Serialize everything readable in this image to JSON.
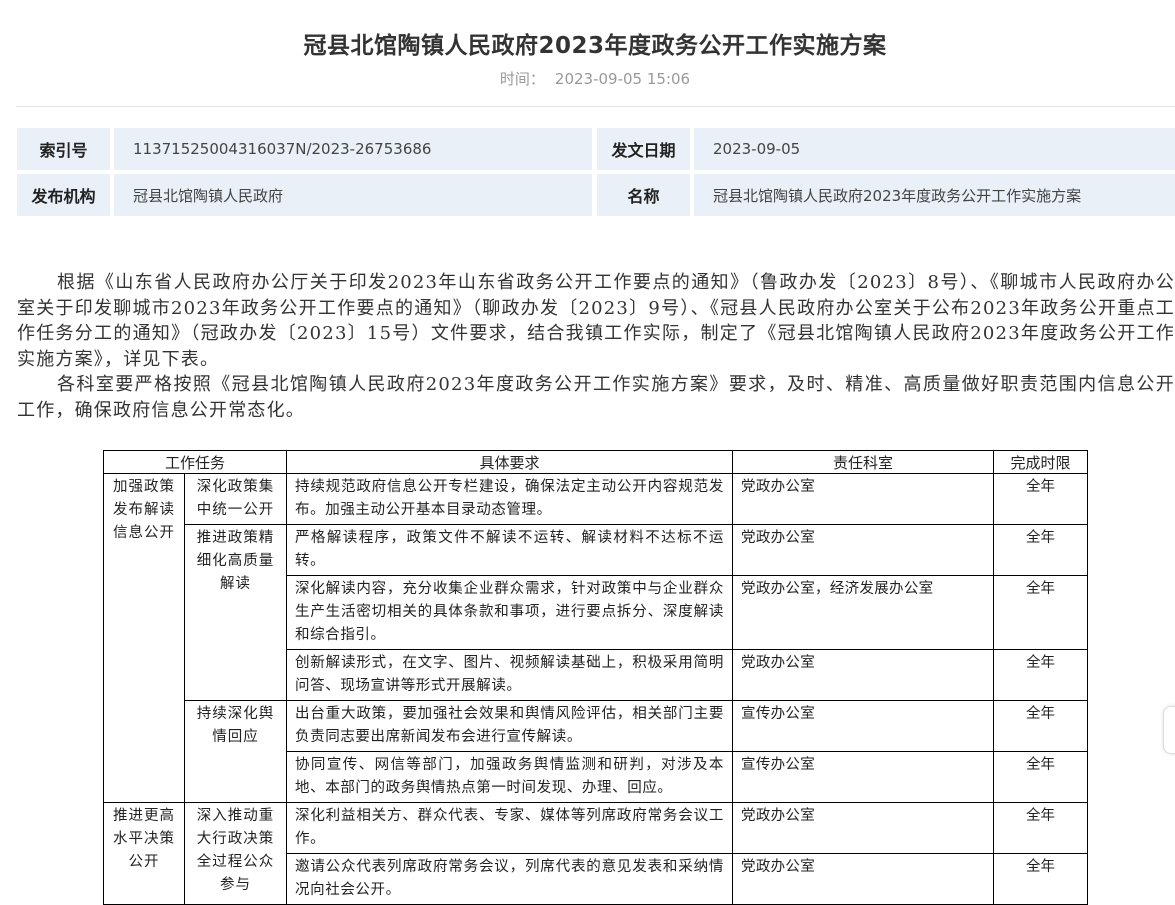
{
  "article": {
    "title": "冠县北馆陶镇人民政府2023年度政务公开工作实施方案",
    "time_label": "时间：",
    "time_value": "2023-09-05 15:06"
  },
  "meta": {
    "index_label": "索引号",
    "index_value": "11371525004316037N/2023-26753686",
    "date_label": "发文日期",
    "date_value": "2023-09-05",
    "org_label": "发布机构",
    "org_value": "冠县北馆陶镇人民政府",
    "name_label": "名称",
    "name_value": "冠县北馆陶镇人民政府2023年度政务公开工作实施方案"
  },
  "body": {
    "p1": "根据《山东省人民政府办公厅关于印发2023年山东省政务公开工作要点的通知》（鲁政办发〔2023〕8号）、《聊城市人民政府办公室关于印发聊城市2023年政务公开工作要点的通知》（聊政办发〔2023〕9号）、《冠县人民政府办公室关于公布2023年政务公开重点工作任务分工的通知》（冠政办发〔2023〕15号）文件要求，结合我镇工作实际，制定了《冠县北馆陶镇人民政府2023年度政务公开工作实施方案》，详见下表。",
    "p2": "各科室要严格按照《冠县北馆陶镇人民政府2023年度政务公开工作实施方案》要求，及时、精准、高质量做好职责范围内信息公开工作，确保政府信息公开常态化。"
  },
  "table": {
    "headers": {
      "task": "工作任务",
      "requirement": "具体要求",
      "office": "责任科室",
      "deadline": "完成时限"
    },
    "group1": "加强政策发布解读信息公开",
    "group2": "推进更高水平决策公开",
    "sub1": "深化政策集中统一公开",
    "sub2": "推进政策精细化高质量解读",
    "sub3": "持续深化舆情回应",
    "sub4": "深入推动重大行政决策全过程公众参与",
    "rows": [
      {
        "req": "持续规范政府信息公开专栏建设，确保法定主动公开内容规范发布。加强主动公开基本目录动态管理。",
        "office": "党政办公室",
        "deadline": "全年"
      },
      {
        "req": "严格解读程序，政策文件不解读不运转、解读材料不达标不运转。",
        "office": "党政办公室",
        "deadline": "全年"
      },
      {
        "req": "深化解读内容，充分收集企业群众需求，针对政策中与企业群众生产生活密切相关的具体条款和事项，进行要点拆分、深度解读和综合指引。",
        "office": "党政办公室，经济发展办公室",
        "deadline": "全年"
      },
      {
        "req": "创新解读形式，在文字、图片、视频解读基础上，积极采用简明问答、现场宣讲等形式开展解读。",
        "office": "党政办公室",
        "deadline": "全年"
      },
      {
        "req": "出台重大政策，要加强社会效果和舆情风险评估，相关部门主要负责同志要出席新闻发布会进行宣传解读。",
        "office": "宣传办公室",
        "deadline": "全年"
      },
      {
        "req": "协同宣传、网信等部门，加强政务舆情监测和研判，对涉及本地、本部门的政务舆情热点第一时间发现、办理、回应。",
        "office": "宣传办公室",
        "deadline": "全年"
      },
      {
        "req": "深化利益相关方、群众代表、专家、媒体等列席政府常务会议工作。",
        "office": "党政办公室",
        "deadline": "全年"
      },
      {
        "req": "邀请公众代表列席政府常务会议，列席代表的意见发表和采纳情况向社会公开。",
        "office": "党政办公室",
        "deadline": "全年"
      }
    ]
  }
}
